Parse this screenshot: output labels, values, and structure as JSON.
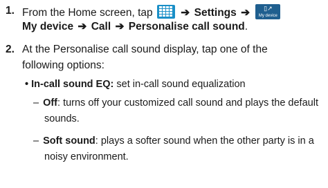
{
  "step1": {
    "number": "1.",
    "text_a": "From the Home screen, tap",
    "arrow_1": "➔",
    "settings": "Settings",
    "arrow_2": "➔",
    "icon_caption": "My device",
    "my_device": "My device",
    "arrow_3": "➔",
    "call": "Call",
    "arrow_4": "➔",
    "personalise": "Personalise call sound",
    "end": "."
  },
  "step2": {
    "number": "2.",
    "line1": "At the Personalise call sound display, tap one of the",
    "line2": "following options:"
  },
  "bullet": {
    "marker": "•",
    "term": "In-call sound EQ:",
    "desc": "set in-call sound equalization"
  },
  "sub_items": [
    {
      "dash": "–",
      "term": "Off",
      "desc_line1": ": turns off your customized call sound and plays the default",
      "desc_line2": "sounds."
    },
    {
      "dash": "–",
      "term": "Soft sound",
      "desc_line1": ": plays a softer sound when the other party is in a",
      "desc_line2": "noisy environment."
    }
  ]
}
